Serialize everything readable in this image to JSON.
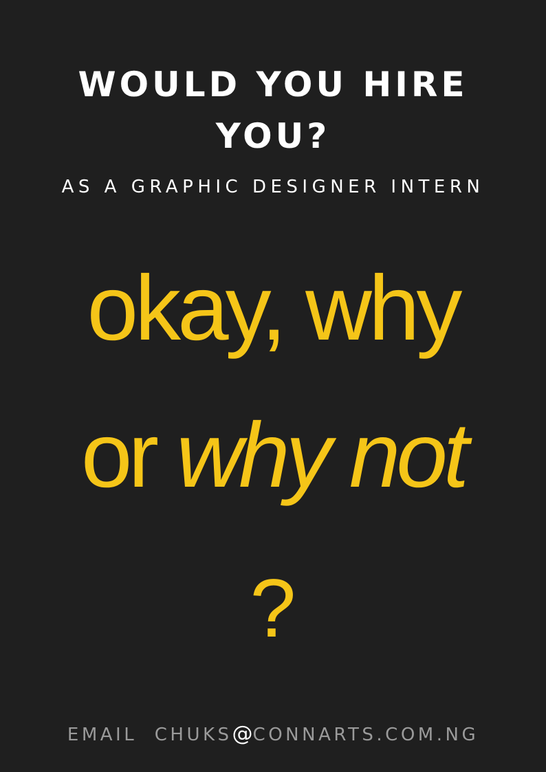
{
  "heading": {
    "line1": "WOULD YOU HIRE",
    "line2": "YOU?"
  },
  "subtitle": "AS A GRAPHIC DESIGNER INTERN",
  "question": {
    "line1": "okay, why",
    "line2_plain": "or",
    "line2_italic": "why not",
    "line3": "?"
  },
  "contact": {
    "label": "EMAIL",
    "user": "CHUKS",
    "at": "@",
    "domain": "CONNARTS.COM.NG"
  },
  "colors": {
    "background": "#1f1f1f",
    "heading": "#ffffff",
    "accent": "#f5c518",
    "footer": "#9a9a9a"
  }
}
